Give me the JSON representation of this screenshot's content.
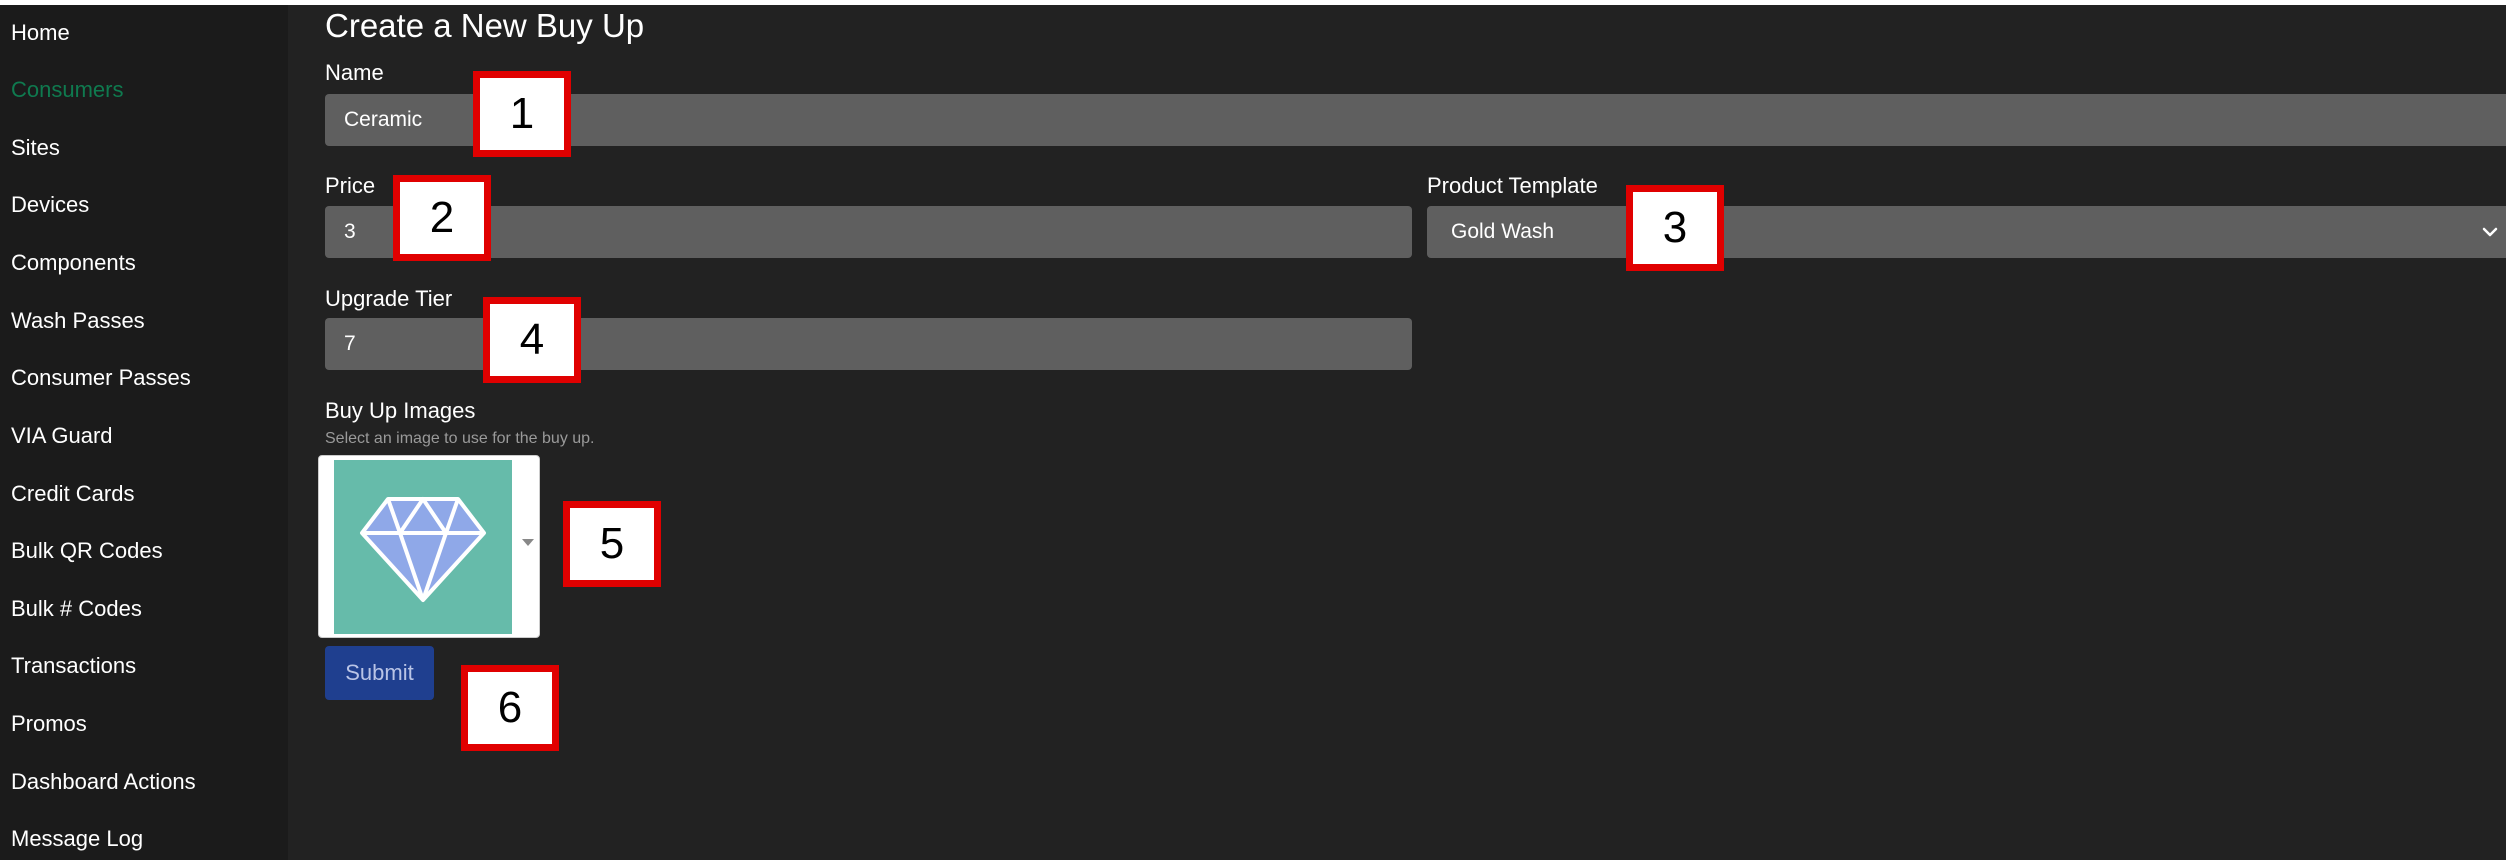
{
  "sidebar": {
    "items": [
      {
        "label": "Home"
      },
      {
        "label": "Consumers"
      },
      {
        "label": "Sites"
      },
      {
        "label": "Devices"
      },
      {
        "label": "Components"
      },
      {
        "label": "Wash Passes"
      },
      {
        "label": "Consumer Passes"
      },
      {
        "label": "VIA Guard"
      },
      {
        "label": "Credit Cards"
      },
      {
        "label": "Bulk QR Codes"
      },
      {
        "label": "Bulk # Codes"
      },
      {
        "label": "Transactions"
      },
      {
        "label": "Promos"
      },
      {
        "label": "Dashboard Actions"
      },
      {
        "label": "Message Log"
      }
    ],
    "active_item": "Consumers",
    "active_color": "#0f7a4f"
  },
  "form": {
    "title": "Create a New Buy Up",
    "name": {
      "label": "Name",
      "value": "Ceramic"
    },
    "price": {
      "label": "Price",
      "value": "3"
    },
    "product_template": {
      "label": "Product Template",
      "selected": "Gold Wash"
    },
    "upgrade_tier": {
      "label": "Upgrade Tier",
      "value": "7"
    },
    "images": {
      "label": "Buy Up Images",
      "help": "Select an image to use for the buy up.",
      "selected_icon": "diamond-icon",
      "thumb_color": "#66bbaa"
    },
    "submit_label": "Submit",
    "submit_color": "#1f3f8f"
  },
  "callouts": [
    "1",
    "2",
    "3",
    "4",
    "5",
    "6"
  ],
  "colors": {
    "background": "#222222",
    "sidebar": "#1b1b1b",
    "input": "#5f5f5f",
    "callout_border": "#e00000"
  }
}
